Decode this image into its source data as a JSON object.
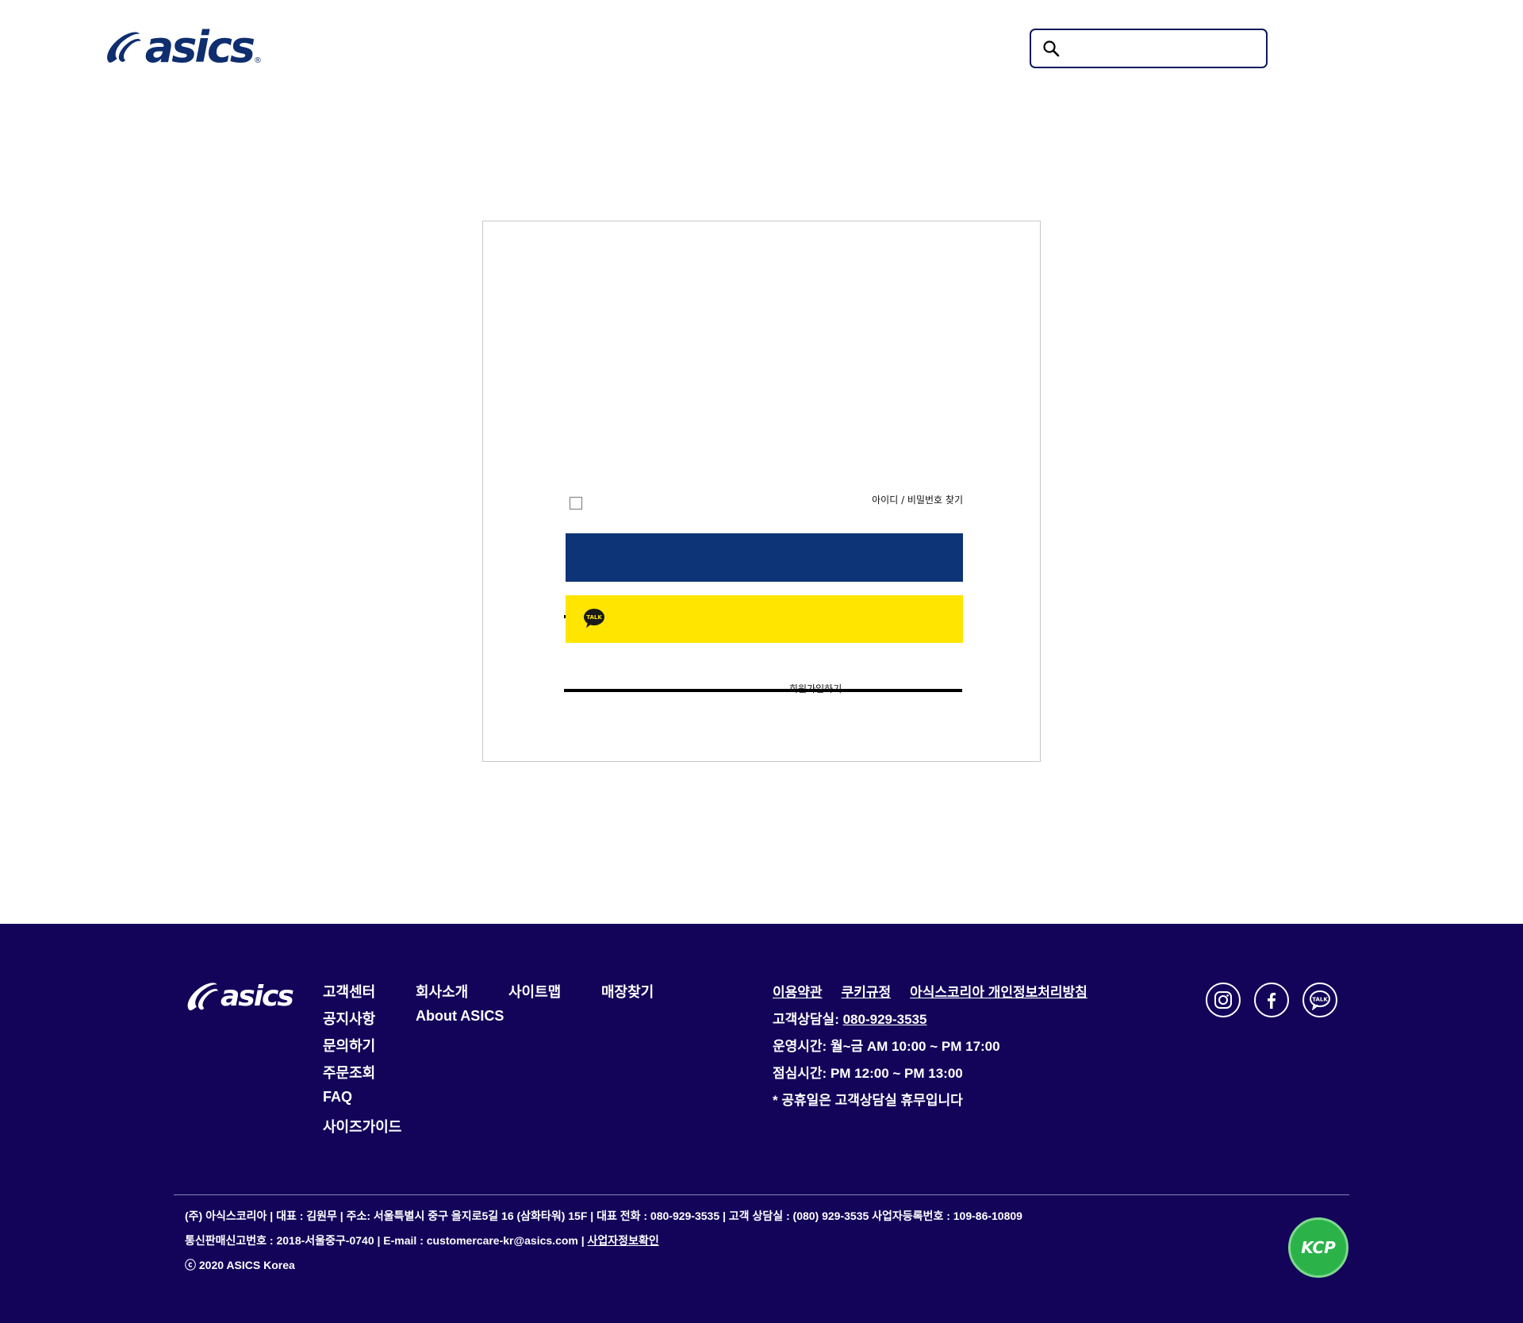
{
  "header": {
    "logo_text": "asics",
    "search": {
      "placeholder": "",
      "value": ""
    }
  },
  "login": {
    "id_placeholder": "",
    "password_placeholder": "",
    "find_link": "아이디 / 비밀번호 찾기",
    "login_button": "",
    "kakao_button": "",
    "kakao_icon_text": "TALK",
    "join_link": "회원가입하기"
  },
  "footer": {
    "logo_text": "asics",
    "nav_col1": [
      "고객센터",
      "공지사항",
      "문의하기",
      "주문조회",
      "FAQ",
      "사이즈가이드"
    ],
    "nav_col2": [
      "회사소개",
      "About ASICS"
    ],
    "nav_col3": [
      "사이트맵"
    ],
    "nav_col4": [
      "매장찾기"
    ],
    "policy_links": [
      "이용약관",
      "쿠키규정",
      "아식스코리아 개인정보처리방침"
    ],
    "contact": {
      "phone_label": "고객상담실: ",
      "phone": "080-929-3535",
      "hours": "운영시간: 월~금 AM 10:00 ~ PM 17:00",
      "lunch": "점심시간: PM 12:00 ~ PM 13:00",
      "holiday": "* 공휴일은 고객상담실 휴무입니다"
    },
    "social_icons": [
      "instagram-icon",
      "facebook-icon",
      "kakaotalk-icon"
    ],
    "biz": {
      "line1": "(주) 아식스코리아 |  대표 : 김원무  |  주소: 서울특별시 중구 을지로5길 16 (삼화타워) 15F  |  대표 전화 : 080-929-3535  |  고객 상담실 : (080) 929-3535 사업자등록번호 : 109-86-10809",
      "line2": "통신판매신고번호 : 2018-서울중구-0740 |  E-mail : customercare-kr@asics.com  |  ",
      "line2_link": "사업자정보확인",
      "copyright": "ⓒ 2020 ASICS Korea"
    },
    "badge_text": "KCP"
  },
  "colors": {
    "brand_navy": "#0f2e6f",
    "login_button": "#0c3477",
    "kakao_yellow": "#ffe500",
    "footer_bg": "#13045a",
    "kcp_green": "#2bb34a"
  }
}
